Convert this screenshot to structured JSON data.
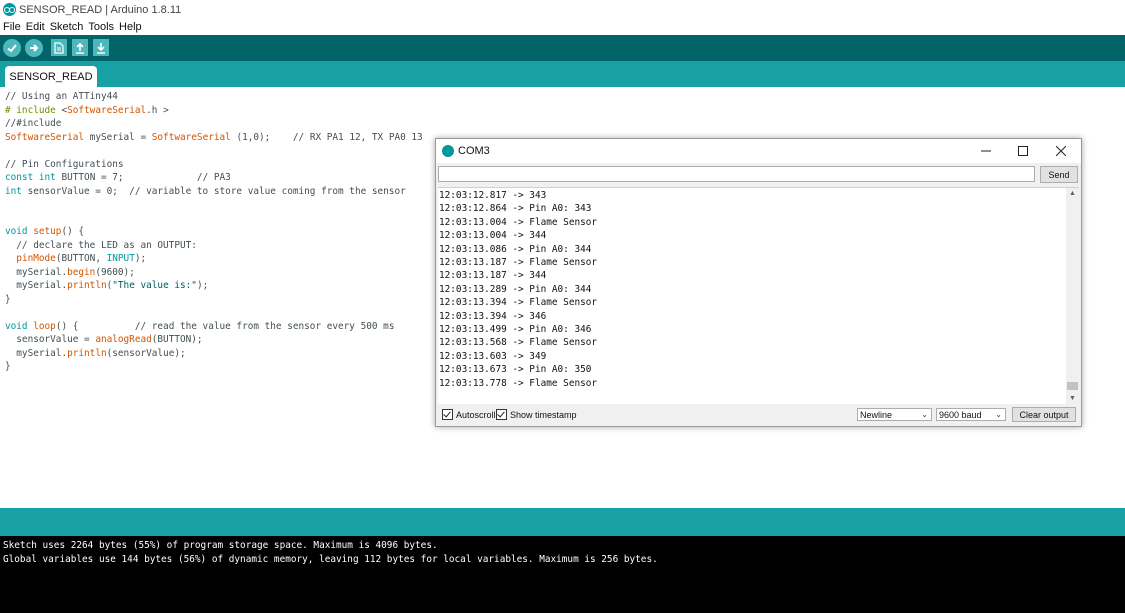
{
  "window": {
    "title": "SENSOR_READ | Arduino 1.8.11"
  },
  "menu": [
    "File",
    "Edit",
    "Sketch",
    "Tools",
    "Help"
  ],
  "toolbar": {
    "icons": [
      "verify-icon",
      "upload-icon",
      "new-icon",
      "open-icon",
      "save-icon"
    ]
  },
  "tab": {
    "label": "SENSOR_READ"
  },
  "code": {
    "lines": [
      [
        {
          "t": "// Using an ATTiny44",
          "c": "com"
        }
      ],
      [
        {
          "t": "# include ",
          "c": "pp"
        },
        {
          "t": "<",
          "c": "com"
        },
        {
          "t": "SoftwareSerial",
          "c": "fn"
        },
        {
          "t": ".h >",
          "c": "com"
        }
      ],
      [
        {
          "t": "//#include",
          "c": "com"
        }
      ],
      [
        {
          "t": "SoftwareSerial",
          "c": "fn"
        },
        {
          "t": " mySerial = ",
          "c": "com"
        },
        {
          "t": "SoftwareSerial",
          "c": "fn"
        },
        {
          "t": " (1,0);    // RX PA1 12, TX PA0 13",
          "c": "com"
        }
      ],
      [
        {
          "t": "",
          "c": "com"
        }
      ],
      [
        {
          "t": "// Pin Configurations",
          "c": "com"
        }
      ],
      [
        {
          "t": "const",
          "c": "kw"
        },
        {
          "t": " ",
          "c": "com"
        },
        {
          "t": "int",
          "c": "kw"
        },
        {
          "t": " BUTTON = 7;             // PA3",
          "c": "com"
        }
      ],
      [
        {
          "t": "int",
          "c": "kw"
        },
        {
          "t": " sensorValue = 0;  // variable to store value coming from the sensor",
          "c": "com"
        }
      ],
      [
        {
          "t": "",
          "c": "com"
        }
      ],
      [
        {
          "t": "",
          "c": "com"
        }
      ],
      [
        {
          "t": "void",
          "c": "kw"
        },
        {
          "t": " ",
          "c": "com"
        },
        {
          "t": "setup",
          "c": "fn"
        },
        {
          "t": "() {",
          "c": "com"
        }
      ],
      [
        {
          "t": "  // declare the LED as an OUTPUT:",
          "c": "com"
        }
      ],
      [
        {
          "t": "  ",
          "c": "com"
        },
        {
          "t": "pinMode",
          "c": "fn"
        },
        {
          "t": "(BUTTON, ",
          "c": "com"
        },
        {
          "t": "INPUT",
          "c": "kw"
        },
        {
          "t": ");",
          "c": "com"
        }
      ],
      [
        {
          "t": "  mySerial.",
          "c": "com"
        },
        {
          "t": "begin",
          "c": "fn"
        },
        {
          "t": "(9600);",
          "c": "com"
        }
      ],
      [
        {
          "t": "  mySerial.",
          "c": "com"
        },
        {
          "t": "println",
          "c": "fn"
        },
        {
          "t": "(",
          "c": "com"
        },
        {
          "t": "\"The value is:\"",
          "c": "str"
        },
        {
          "t": ");",
          "c": "com"
        }
      ],
      [
        {
          "t": "}",
          "c": "com"
        }
      ],
      [
        {
          "t": "",
          "c": "com"
        }
      ],
      [
        {
          "t": "void",
          "c": "kw"
        },
        {
          "t": " ",
          "c": "com"
        },
        {
          "t": "loop",
          "c": "fn"
        },
        {
          "t": "() {          // read the value from the sensor every 500 ms",
          "c": "com"
        }
      ],
      [
        {
          "t": "  sensorValue = ",
          "c": "com"
        },
        {
          "t": "analogRead",
          "c": "fn"
        },
        {
          "t": "(BUTTON);",
          "c": "com"
        }
      ],
      [
        {
          "t": "  mySerial.",
          "c": "com"
        },
        {
          "t": "println",
          "c": "fn"
        },
        {
          "t": "(sensorValue);",
          "c": "com"
        }
      ],
      [
        {
          "t": "}",
          "c": "com"
        }
      ]
    ]
  },
  "console": {
    "lines": [
      "Sketch uses 2264 bytes (55%) of program storage space. Maximum is 4096 bytes.",
      "Global variables use 144 bytes (56%) of dynamic memory, leaving 112 bytes for local variables. Maximum is 256 bytes."
    ]
  },
  "serial_monitor": {
    "title": "COM3",
    "input_value": "",
    "send_label": "Send",
    "output_lines": [
      "12:03:12.817 -> 343",
      "12:03:12.864 -> Pin A0: 343",
      "12:03:13.004 -> Flame Sensor",
      "12:03:13.004 -> 344",
      "12:03:13.086 -> Pin A0: 344",
      "12:03:13.187 -> Flame Sensor",
      "12:03:13.187 -> 344",
      "12:03:13.289 -> Pin A0: 344",
      "12:03:13.394 -> Flame Sensor",
      "12:03:13.394 -> 346",
      "12:03:13.499 -> Pin A0: 346",
      "12:03:13.568 -> Flame Sensor",
      "12:03:13.603 -> 349",
      "12:03:13.673 -> Pin A0: 350",
      "12:03:13.778 -> Flame Sensor"
    ],
    "autoscroll_label": "Autoscroll",
    "autoscroll_checked": true,
    "timestamp_label": "Show timestamp",
    "timestamp_checked": true,
    "line_ending": "Newline",
    "baud": "9600 baud",
    "clear_label": "Clear output"
  },
  "colors": {
    "teal_dark": "#006468",
    "teal": "#17a1a5",
    "accent": "#00979c",
    "keyword": "#00979c",
    "function": "#d35400"
  }
}
